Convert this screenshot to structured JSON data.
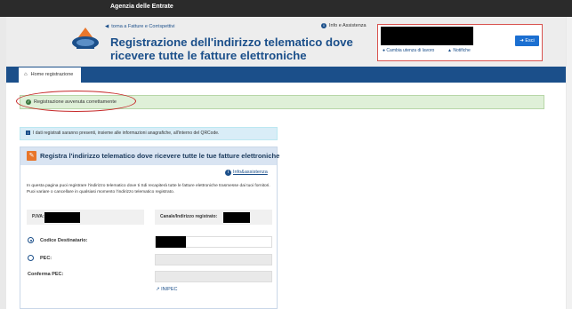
{
  "topbar": {
    "org": "Agenzia delle Entrate"
  },
  "header": {
    "back_link": "torna a Fatture e Corrispettivi",
    "info_link": "Info e Assistenza",
    "title": "Registrazione dell'indirizzo telematico dove ricevere tutte le fatture elettroniche",
    "change_user": "Cambia utenza di lavoro",
    "notifications": "Notifiche",
    "exit": "Esci"
  },
  "nav": {
    "home_tab": "Home registrazione"
  },
  "alerts": {
    "success": "Registrazione avvenuta correttamente",
    "info": "I dati registrati saranno presenti, insieme alle informazioni anagrafiche, all'interno del QRCode."
  },
  "panel": {
    "title": "Registra l'indirizzo telematico dove ricevere tutte le tue fatture elettroniche",
    "help": "Info&assistenza",
    "description": "In questa pagina puoi registrare l'indirizzo telematico dove ti Sdi recapiterà tutte le fatture elettroniche trasmesse dai tuoi fornitori. Puoi variare o cancellare in qualsiasi momento l'indirizzo telematico registrato.",
    "piva_label": "P.IVA:",
    "canale_label": "Canale/Indirizzo registrato:",
    "codice_label": "Codice Destinatario:",
    "pec_label": "PEC:",
    "conferma_label": "Conferma PEC:",
    "inpec": "INIPEC"
  },
  "colors": {
    "brand": "#1b4f8a",
    "success_bg": "#dff0d8",
    "info_bg": "#d9edf7",
    "highlight": "#c62828"
  }
}
